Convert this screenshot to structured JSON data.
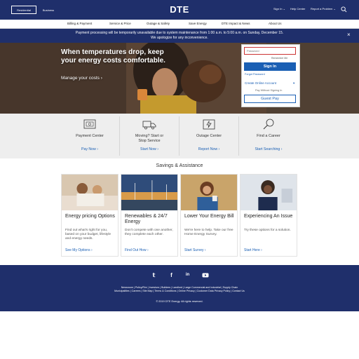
{
  "header": {
    "segments": [
      "Residential",
      "Business"
    ],
    "logo": "DTE",
    "signin": "Sign In",
    "help": "Help Center",
    "report": "Report a Problem"
  },
  "nav": {
    "items": [
      "Billing & Payment",
      "Service & Price",
      "Outage & Safety",
      "Save Energy",
      "DTE Impact & News",
      "About Us"
    ]
  },
  "alert": {
    "line1": "Payment processing will be temporarily unavailable due to system maintenance from 1:00 a.m. to 5:00 a.m. on Sunday, December 15.",
    "line2": "We apologize for any inconvenience."
  },
  "hero": {
    "headline": "When temperatures drop, keep your energy costs comfortable.",
    "link": "Manage your costs"
  },
  "login": {
    "password_placeholder": "Password",
    "remember": "Remember Me",
    "signin_button": "Sign In",
    "forgot": "Forgot Password",
    "create": "Create Online Account",
    "pay_without": "Pay Without Signing In",
    "guest_pay": "Guest Pay"
  },
  "tiles": [
    {
      "title": "Payment Center",
      "link": "Pay Now",
      "icon": "payment-icon"
    },
    {
      "title": "Moving? Start or Stop Service",
      "link": "Start Now",
      "icon": "truck-icon"
    },
    {
      "title": "Outage Center",
      "link": "Report Now",
      "icon": "outage-icon"
    },
    {
      "title": "Find a Career",
      "link": "Start Searching",
      "icon": "career-icon"
    }
  ],
  "savings": {
    "title": "Savings & Assistance",
    "cards": [
      {
        "title": "Energy pricing Options",
        "desc": "Find out what's right for you, based on your budget, lifestyle and energy needs.",
        "link": "See My Options"
      },
      {
        "title": "Renewables & 24/7 Energy",
        "desc": "Don't compete with one another, they complete each other.",
        "link": "Find Out How"
      },
      {
        "title": "Lower Your Energy Bill",
        "desc": "We're here to help. Take our free Home Energy Survey.",
        "link": "Start Survey"
      },
      {
        "title": "Experiencing An Issue",
        "desc": "Try these options for a solution.",
        "link": "Start Here"
      }
    ]
  },
  "footer": {
    "social": [
      "twitter-icon",
      "facebook-icon",
      "linkedin-icon",
      "youtube-icon"
    ],
    "links_row1": "Newsroom   |   Policy/Fire   |   Investors   |   Builders   |   Landlord   |   Large Commercial and Industrial   |   Supply Chain",
    "links_row2": "Municipalities   |   Careers   |   Site Map   |   Terms & Conditions   |   Online Privacy   |   Customer Data Privacy Policy   |   Contact Us",
    "copyright": "© 2019 DTE Energy. All rights reserved."
  },
  "colors": {
    "navy": "#1f2f6b",
    "link_blue": "#1a5fb4"
  }
}
